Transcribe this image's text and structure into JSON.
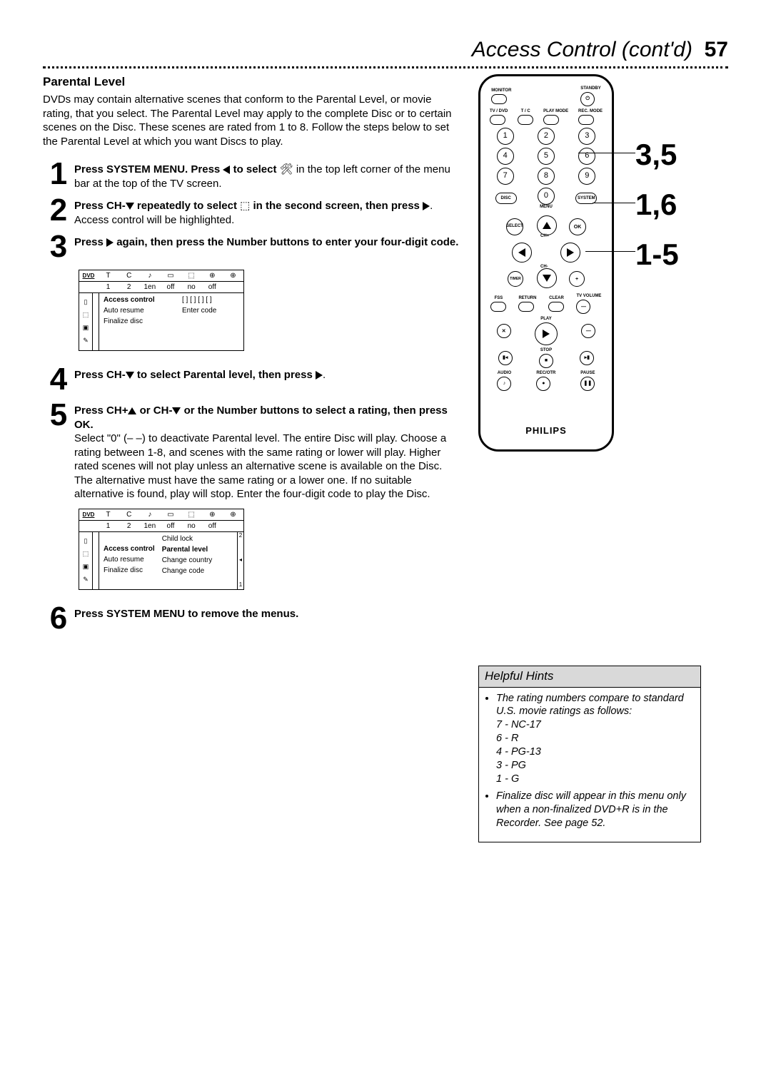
{
  "page": {
    "title": "Access Control (cont'd)",
    "number": "57"
  },
  "section_heading": "Parental Level",
  "intro": "DVDs may contain alternative scenes that conform to the Parental Level, or movie rating, that you select. The Parental Level may apply to the complete Disc or to certain scenes on the Disc. These scenes are rated from 1 to 8. Follow the steps below to set the Parental Level at which you want Discs to play.",
  "steps": {
    "s1a": "Press SYSTEM MENU. Press",
    "s1b": "to select",
    "s1c": "in the top left corner of the menu bar at the top of the TV screen.",
    "s2a": "Press CH-",
    "s2b": "repeatedly to select",
    "s2c": "in the second screen, then press",
    "s2d": ". Access control will be highlighted.",
    "s3a": "Press",
    "s3b": "again, then press the Number buttons to enter your four-digit code.",
    "s4a": "Press CH-",
    "s4b": "to select Parental level, then press",
    "s4c": ".",
    "s5a": "Press CH+",
    "s5b": "or CH-",
    "s5c": "or the Number buttons to select a rating, then press OK.",
    "s5body": "Select \"0\" (– –) to deactivate Parental level. The entire Disc will play. Choose a rating between 1-8, and scenes with the same rating or lower will play. Higher rated scenes will not play unless an alterna­tive scene is available on the Disc. The alternative must have the same rating or a lower one. If no suitable alternative is found, play will stop. Enter the four-digit code to play the Disc.",
    "s6": "Press SYSTEM MENU to remove the menus."
  },
  "osd": {
    "top_icons": [
      "T",
      "C",
      "♪",
      "▭",
      "⬚",
      "⊕"
    ],
    "top_vals": [
      "1",
      "2",
      "1en",
      "off",
      "no",
      "off"
    ],
    "list_a": [
      "Access control",
      "Auto resume",
      "Finalize disc"
    ],
    "right_a": "Enter code",
    "right_a_slots": "[ ] [ ] [ ] [ ]",
    "list_b_left": [
      "Access control",
      "Auto resume",
      "Finalize disc"
    ],
    "list_b_right": [
      "Child lock",
      "Parental level",
      "Change country",
      "Change code"
    ],
    "scroll_top": "2",
    "scroll_bot": "1"
  },
  "remote": {
    "monitor": "MONITOR",
    "standby": "STANDBY",
    "row2": [
      "TV / DVD",
      "T / C",
      "PLAY MODE",
      "REC. MODE"
    ],
    "nums": [
      "1",
      "2",
      "3",
      "4",
      "5",
      "6",
      "7",
      "8",
      "9",
      "0"
    ],
    "disc": "DISC",
    "menu": "MENU",
    "system": "SYSTEM",
    "select": "SELECT",
    "ok": "OK",
    "chp": "CH+",
    "chm": "CH-",
    "timer": "TIMER",
    "fss": "FSS",
    "return": "RETURN",
    "clear": "CLEAR",
    "tvvol": "TV VOLUME",
    "play": "PLAY",
    "stop": "STOP",
    "audio": "AUDIO",
    "recotr": "REC/OTR",
    "pause": "PAUSE",
    "brand": "PHILIPS"
  },
  "annot": {
    "a1": "3,5",
    "a2": "1,6",
    "a3": "1-5"
  },
  "hints": {
    "title": "Helpful Hints",
    "b1": "The rating numbers compare to standard U.S. movie ratings as fol­lows:",
    "r1": "7 - NC-17",
    "r2": "6 - R",
    "r3": "4 - PG-13",
    "r4": "3 - PG",
    "r5": "1 - G",
    "b2": "Finalize disc will appear in this menu only when a non-finalized DVD+R is in the Recorder. See page 52."
  }
}
